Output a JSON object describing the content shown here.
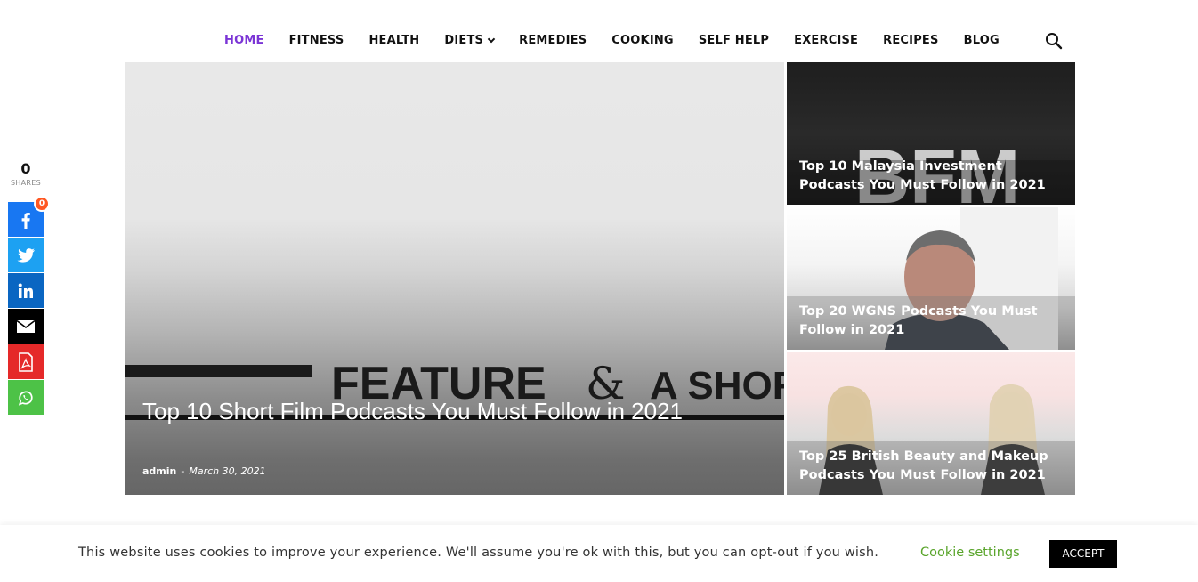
{
  "nav": {
    "items": [
      {
        "label": "HOME",
        "active": true
      },
      {
        "label": "FITNESS"
      },
      {
        "label": "HEALTH"
      },
      {
        "label": "DIETS",
        "has_dropdown": true
      },
      {
        "label": "REMEDIES"
      },
      {
        "label": "COOKING"
      },
      {
        "label": "SELF HELP"
      },
      {
        "label": "EXERCISE"
      },
      {
        "label": "RECIPES"
      },
      {
        "label": "BLOG"
      }
    ],
    "search_icon": "search-icon",
    "active_color": "#7b35d6"
  },
  "featured": {
    "image_text_main": "FEATURE",
    "image_text_amp": "&",
    "image_text_tail": "A SHORT",
    "title": "Top 10 Short Film Podcasts You Must Follow in 2021",
    "author": "admin",
    "separator": "-",
    "date": "March 30, 2021"
  },
  "side_posts": [
    {
      "title": "Top 10 Malaysia Investment Podcasts You Must Follow in 2021",
      "image_text": "BFM"
    },
    {
      "title": "Top 20 WGNS Podcasts You Must Follow in 2021"
    },
    {
      "title": "Top 25 British Beauty and Makeup Podcasts You Must Follow in 2021"
    }
  ],
  "share": {
    "count": "0",
    "label": "SHARES",
    "facebook_badge": "0",
    "buttons": [
      "facebook-icon",
      "twitter-icon",
      "linkedin-icon",
      "email-icon",
      "pdf-icon",
      "whatsapp-icon"
    ],
    "colors": {
      "facebook": "#1877f2",
      "twitter": "#1da1f2",
      "linkedin": "#0a66c2",
      "email": "#000000",
      "pdf": "#e52929",
      "whatsapp": "#4dc247"
    }
  },
  "cookie": {
    "message": "This website uses cookies to improve your experience. We'll assume you're ok with this, but you can opt-out if you wish.",
    "settings_label": "Cookie settings",
    "accept_label": "ACCEPT",
    "settings_color": "#5aa52c"
  }
}
